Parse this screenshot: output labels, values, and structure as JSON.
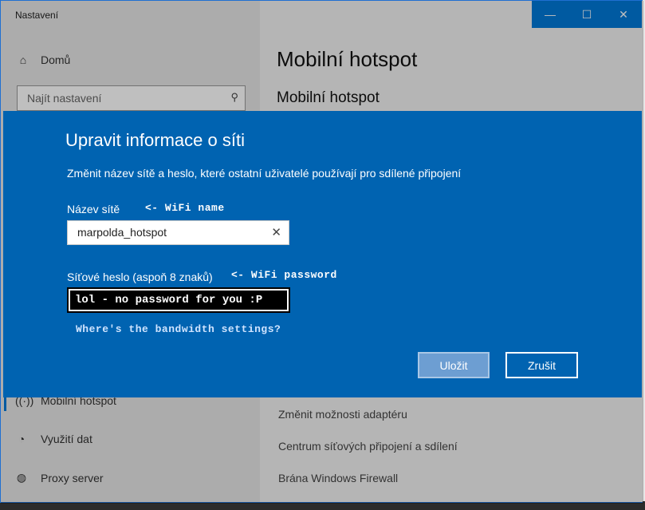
{
  "window": {
    "title": "Nastavení",
    "minimize_glyph": "—",
    "maximize_glyph": "☐",
    "close_glyph": "✕"
  },
  "sidebar": {
    "home_label": "Domů",
    "search_placeholder": "Najít nastavení",
    "items": [
      {
        "label": "Mobilní hotspot",
        "icon": "hotspot-icon"
      },
      {
        "label": "Využití dat",
        "icon": "data-usage-icon"
      },
      {
        "label": "Proxy server",
        "icon": "globe-icon"
      }
    ]
  },
  "content": {
    "page_title": "Mobilní hotspot",
    "section_title": "Mobilní hotspot",
    "related_links": [
      "Změnit možnosti adaptéru",
      "Centrum síťových připojení a sdílení",
      "Brána Windows Firewall"
    ]
  },
  "dialog": {
    "title": "Upravit informace o síti",
    "description": "Změnit název sítě a heslo, které ostatní uživatelé používají pro sdílené připojení",
    "name_label": "Název sítě",
    "name_annotation": "<- WiFi name",
    "name_value": "marpolda_hotspot",
    "password_label": "Síťové heslo (aspoň 8 znaků)",
    "password_annotation": "<- WiFi password",
    "password_value": "lol - no password for you :P",
    "bandwidth_note": "Where's the bandwidth settings?",
    "save_label": "Uložit",
    "cancel_label": "Zrušit"
  },
  "colors": {
    "accent": "#0078d7",
    "dialog_bg": "#0063b1"
  }
}
